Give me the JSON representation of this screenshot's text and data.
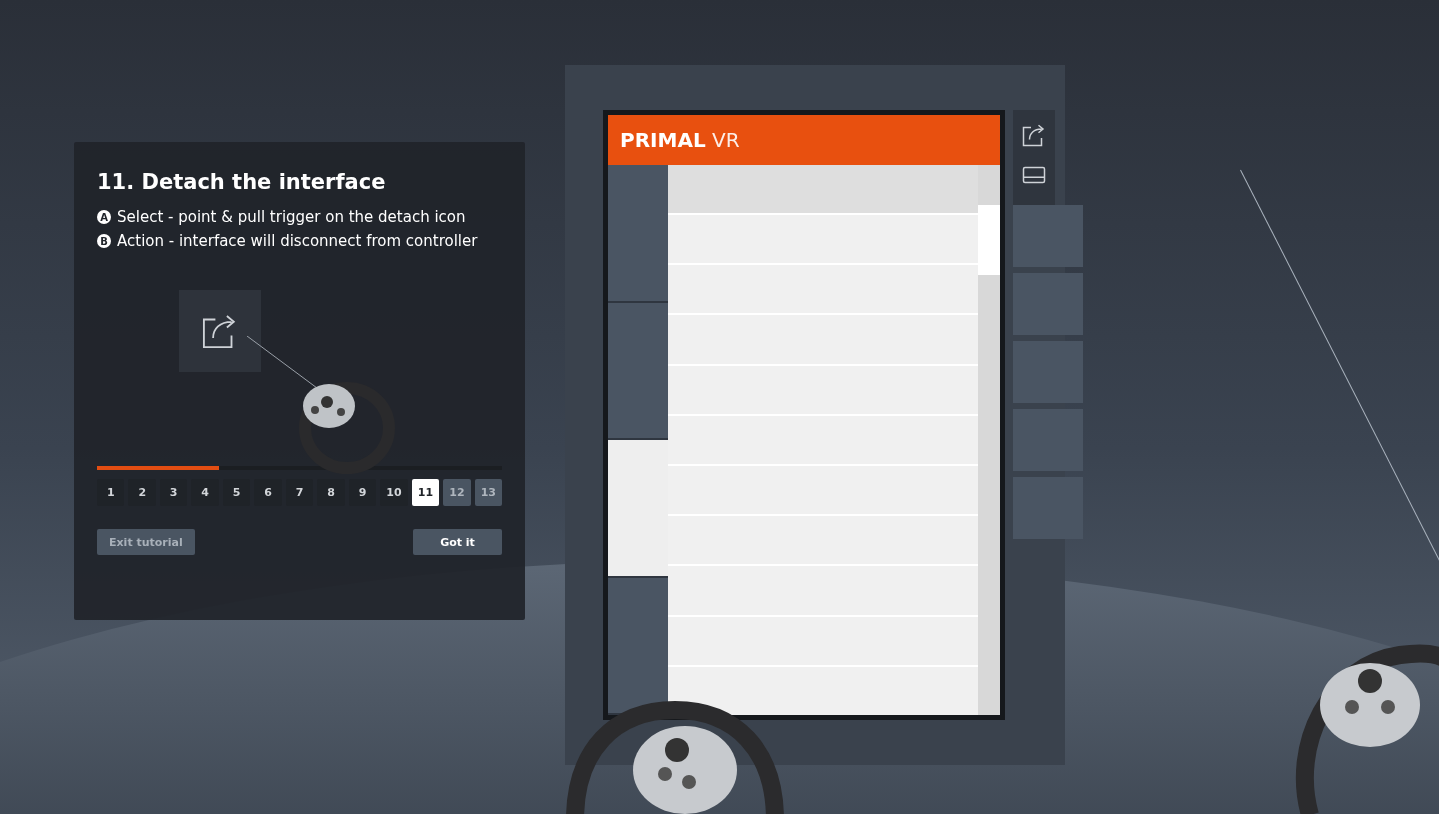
{
  "tutorial": {
    "title": "11. Detach the interface",
    "steps": [
      {
        "badge": "A",
        "text": "Select - point & pull trigger on the detach icon"
      },
      {
        "badge": "B",
        "text": "Action - interface will disconnect from controller"
      }
    ],
    "progress": {
      "level": 0.3
    },
    "pages": [
      {
        "label": "1",
        "selected": false,
        "done": true
      },
      {
        "label": "2",
        "selected": false,
        "done": true
      },
      {
        "label": "3",
        "selected": false,
        "done": true
      },
      {
        "label": "4",
        "selected": false,
        "done": true
      },
      {
        "label": "5",
        "selected": false,
        "done": true
      },
      {
        "label": "6",
        "selected": false,
        "done": true
      },
      {
        "label": "7",
        "selected": false,
        "done": true
      },
      {
        "label": "8",
        "selected": false,
        "done": true
      },
      {
        "label": "9",
        "selected": false,
        "done": true
      },
      {
        "label": "10",
        "selected": false,
        "done": true
      },
      {
        "label": "11",
        "selected": true,
        "done": false
      },
      {
        "label": "12",
        "selected": false,
        "done": false
      },
      {
        "label": "13",
        "selected": false,
        "done": false
      }
    ],
    "buttons": [
      {
        "label": "Exit tutorial",
        "kind": "secondary"
      },
      {
        "label": "Got it",
        "kind": "primary"
      }
    ]
  },
  "app": {
    "brand": "PRIMAL",
    "brand_suffix": "VR"
  }
}
